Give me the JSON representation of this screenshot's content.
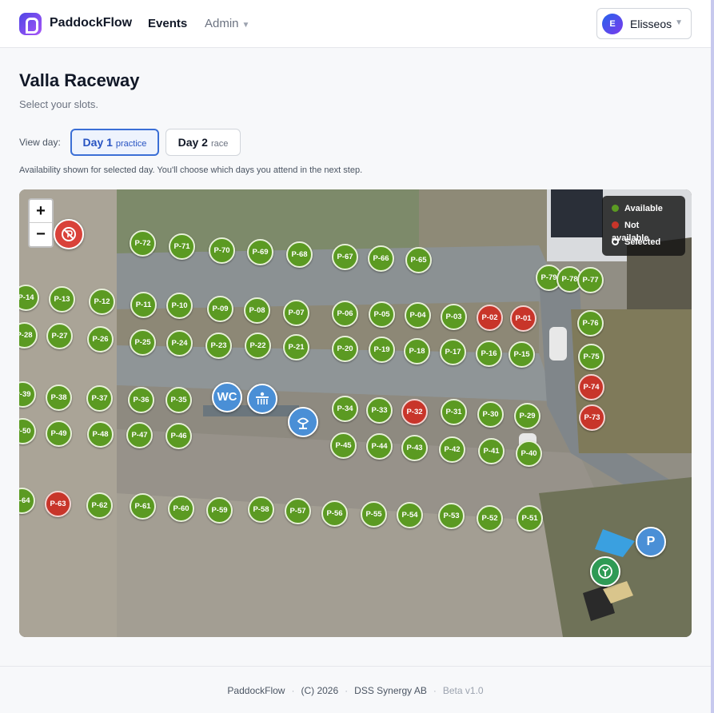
{
  "app": {
    "brand": "PaddockFlow"
  },
  "nav": {
    "events": "Events",
    "admin": "Admin",
    "admin_caret": "▼"
  },
  "user": {
    "initial": "E",
    "name": "Elisseos",
    "caret": "▼"
  },
  "page": {
    "title": "Valla Raceway",
    "subtitle": "Select your slots.",
    "view_day_label": "View day:",
    "days": [
      {
        "label": "Day 1",
        "sub": "practice",
        "selected": true
      },
      {
        "label": "Day 2",
        "sub": "race",
        "selected": false
      }
    ],
    "note": "Availability shown for selected day. You'll choose which days you attend in the next step."
  },
  "map": {
    "zoom_in": "+",
    "zoom_out": "−",
    "legend": [
      {
        "label": "Available",
        "color": "#5b9a22"
      },
      {
        "label": "Not available",
        "color": "#c8352a"
      },
      {
        "label": "Selected",
        "color": "#ffffff"
      }
    ],
    "pois": [
      {
        "name": "wc-icon",
        "label": "WC"
      },
      {
        "name": "shower-icon",
        "label": ""
      },
      {
        "name": "sink-icon",
        "label": ""
      },
      {
        "name": "parking-icon",
        "label": "P"
      },
      {
        "name": "first-aid-icon",
        "label": ""
      },
      {
        "name": "no-entry-icon",
        "label": ""
      }
    ],
    "slots": [
      {
        "id": "P-72",
        "status": "available"
      },
      {
        "id": "P-71",
        "status": "available"
      },
      {
        "id": "P-70",
        "status": "available"
      },
      {
        "id": "P-69",
        "status": "available"
      },
      {
        "id": "P-68",
        "status": "available"
      },
      {
        "id": "P-67",
        "status": "available"
      },
      {
        "id": "P-66",
        "status": "available"
      },
      {
        "id": "P-65",
        "status": "available"
      },
      {
        "id": "P-79",
        "status": "available"
      },
      {
        "id": "P-78",
        "status": "available"
      },
      {
        "id": "P-77",
        "status": "available"
      },
      {
        "id": "P-14",
        "status": "available"
      },
      {
        "id": "P-13",
        "status": "available"
      },
      {
        "id": "P-12",
        "status": "available"
      },
      {
        "id": "P-11",
        "status": "available"
      },
      {
        "id": "P-10",
        "status": "available"
      },
      {
        "id": "P-09",
        "status": "available"
      },
      {
        "id": "P-08",
        "status": "available"
      },
      {
        "id": "P-07",
        "status": "available"
      },
      {
        "id": "P-06",
        "status": "available"
      },
      {
        "id": "P-05",
        "status": "available"
      },
      {
        "id": "P-04",
        "status": "available"
      },
      {
        "id": "P-03",
        "status": "available"
      },
      {
        "id": "P-02",
        "status": "unavailable"
      },
      {
        "id": "P-01",
        "status": "unavailable"
      },
      {
        "id": "P-76",
        "status": "available"
      },
      {
        "id": "P-28",
        "status": "available"
      },
      {
        "id": "P-27",
        "status": "available"
      },
      {
        "id": "P-26",
        "status": "available"
      },
      {
        "id": "P-25",
        "status": "available"
      },
      {
        "id": "P-24",
        "status": "available"
      },
      {
        "id": "P-23",
        "status": "available"
      },
      {
        "id": "P-22",
        "status": "available"
      },
      {
        "id": "P-21",
        "status": "available"
      },
      {
        "id": "P-20",
        "status": "available"
      },
      {
        "id": "P-19",
        "status": "available"
      },
      {
        "id": "P-18",
        "status": "available"
      },
      {
        "id": "P-17",
        "status": "available"
      },
      {
        "id": "P-16",
        "status": "available"
      },
      {
        "id": "P-15",
        "status": "available"
      },
      {
        "id": "P-75",
        "status": "available"
      },
      {
        "id": "P-74",
        "status": "unavailable"
      },
      {
        "id": "P-73",
        "status": "unavailable"
      },
      {
        "id": "P-39",
        "status": "available"
      },
      {
        "id": "P-38",
        "status": "available"
      },
      {
        "id": "P-37",
        "status": "available"
      },
      {
        "id": "P-36",
        "status": "available"
      },
      {
        "id": "P-35",
        "status": "available"
      },
      {
        "id": "P-34",
        "status": "available"
      },
      {
        "id": "P-33",
        "status": "available"
      },
      {
        "id": "P-32",
        "status": "unavailable"
      },
      {
        "id": "P-31",
        "status": "available"
      },
      {
        "id": "P-30",
        "status": "available"
      },
      {
        "id": "P-29",
        "status": "available"
      },
      {
        "id": "P-50",
        "status": "available"
      },
      {
        "id": "P-49",
        "status": "available"
      },
      {
        "id": "P-48",
        "status": "available"
      },
      {
        "id": "P-47",
        "status": "available"
      },
      {
        "id": "P-46",
        "status": "available"
      },
      {
        "id": "P-45",
        "status": "available"
      },
      {
        "id": "P-44",
        "status": "available"
      },
      {
        "id": "P-43",
        "status": "available"
      },
      {
        "id": "P-42",
        "status": "available"
      },
      {
        "id": "P-41",
        "status": "available"
      },
      {
        "id": "P-40",
        "status": "available"
      },
      {
        "id": "P-64",
        "status": "available"
      },
      {
        "id": "P-63",
        "status": "unavailable"
      },
      {
        "id": "P-62",
        "status": "available"
      },
      {
        "id": "P-61",
        "status": "available"
      },
      {
        "id": "P-60",
        "status": "available"
      },
      {
        "id": "P-59",
        "status": "available"
      },
      {
        "id": "P-58",
        "status": "available"
      },
      {
        "id": "P-57",
        "status": "available"
      },
      {
        "id": "P-56",
        "status": "available"
      },
      {
        "id": "P-55",
        "status": "available"
      },
      {
        "id": "P-54",
        "status": "available"
      },
      {
        "id": "P-53",
        "status": "available"
      },
      {
        "id": "P-52",
        "status": "available"
      },
      {
        "id": "P-51",
        "status": "available"
      }
    ]
  },
  "footer": {
    "brand": "PaddockFlow",
    "copyright": "(C) 2026",
    "company": "DSS Synergy AB",
    "version": "Beta v1.0",
    "separator": "·"
  }
}
